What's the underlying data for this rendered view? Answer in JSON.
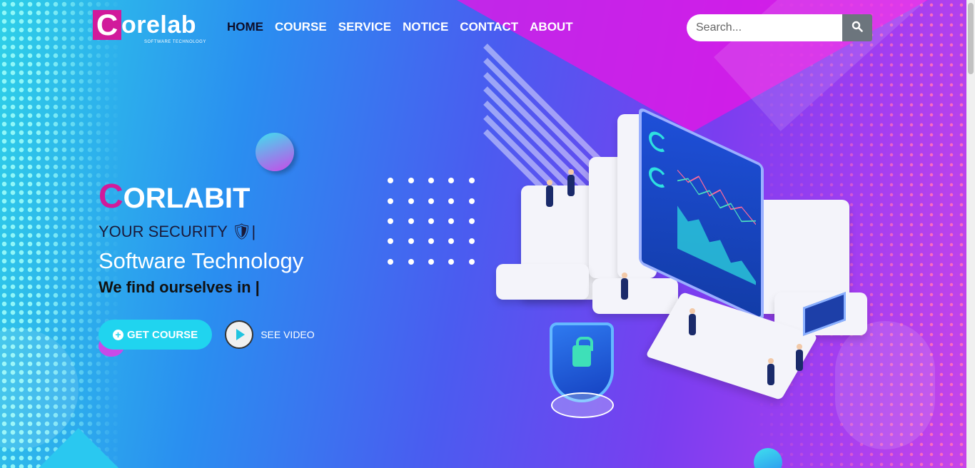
{
  "brand": {
    "logo_letter": "C",
    "logo_text": "orelab",
    "logo_sub": "SOFTWARE TECHNOLOGY"
  },
  "nav": {
    "items": [
      {
        "label": "HOME",
        "active": true
      },
      {
        "label": "COURSE",
        "active": false
      },
      {
        "label": "SERVICE",
        "active": false
      },
      {
        "label": "NOTICE",
        "active": false
      },
      {
        "label": "CONTACT",
        "active": false
      },
      {
        "label": "ABOUT",
        "active": false
      }
    ]
  },
  "search": {
    "placeholder": "Search...",
    "icon": "search-icon"
  },
  "hero": {
    "title_first": "C",
    "title_rest": "ORLABIT",
    "line1": "YOUR SECURITY 🛡|",
    "line2": "Software Technology",
    "line3": "We find ourselves in |",
    "primary_button": "GET COURSE",
    "video_label": "SEE VIDEO"
  },
  "colors": {
    "brand_magenta": "#d11a9b",
    "button_cyan": "#20d4ef",
    "search_button": "#6c757d"
  }
}
